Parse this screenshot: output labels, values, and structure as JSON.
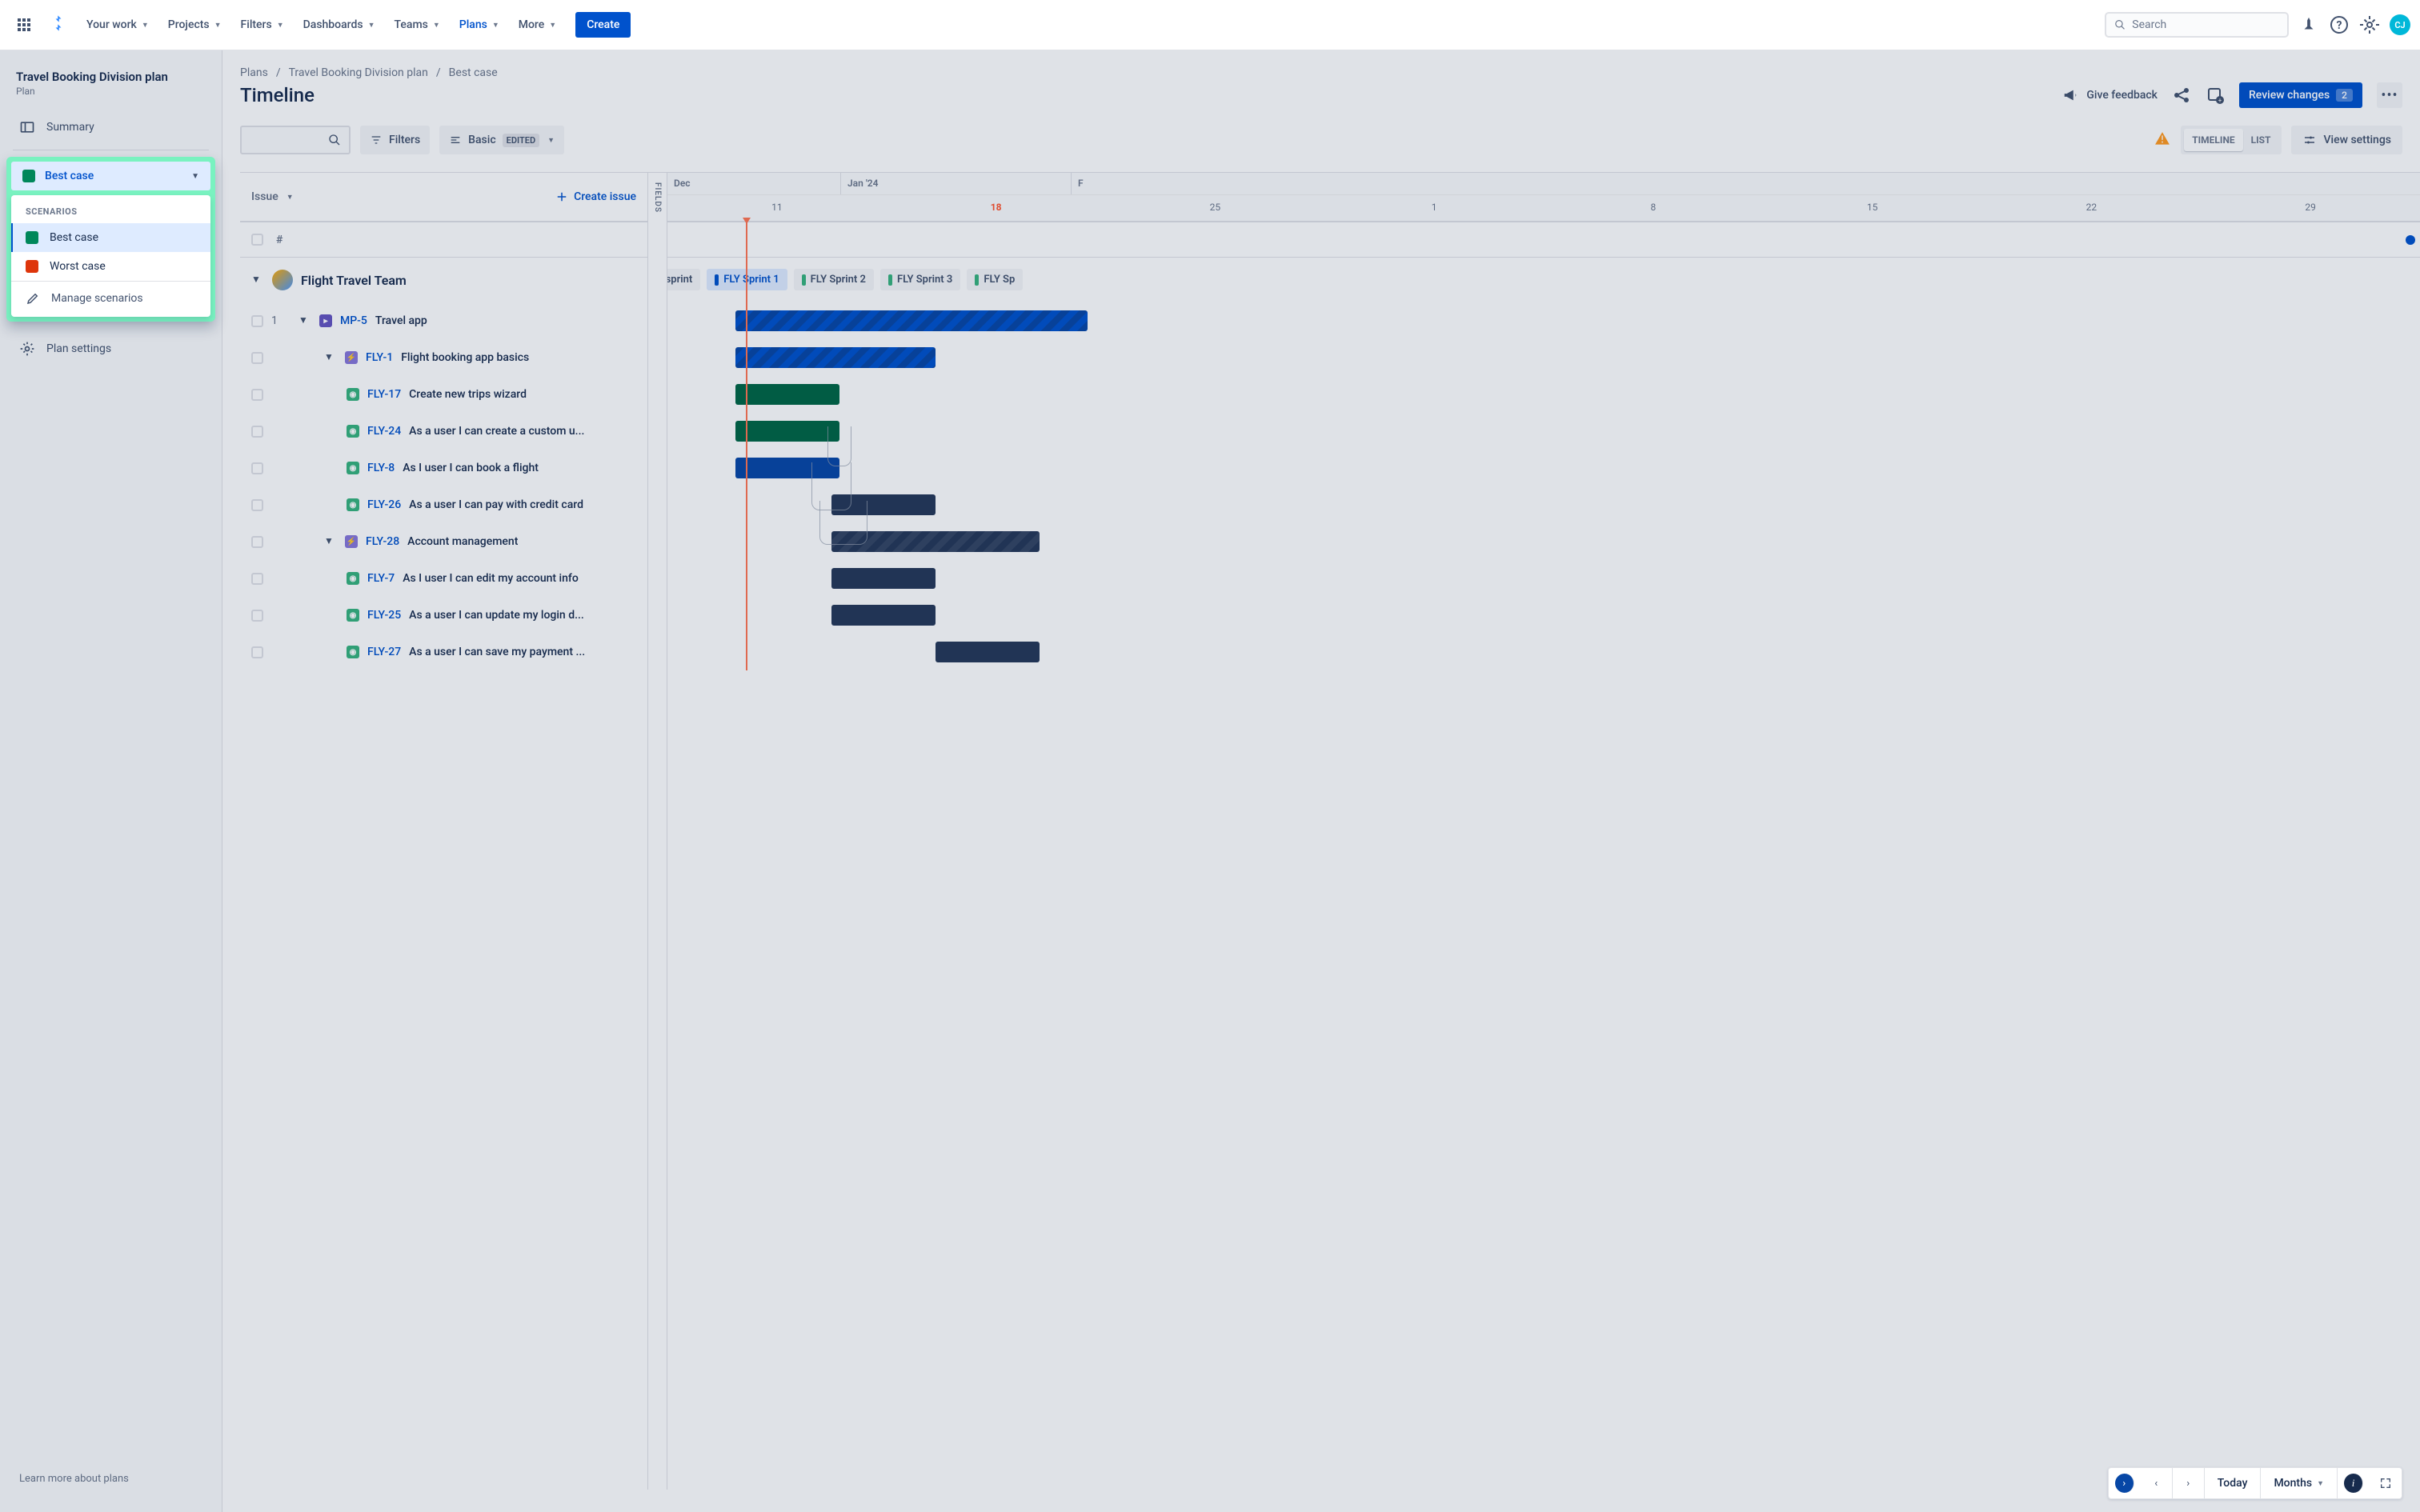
{
  "topnav": {
    "items": [
      "Your work",
      "Projects",
      "Filters",
      "Dashboards",
      "Teams",
      "Plans",
      "More"
    ],
    "active_index": 5,
    "create_label": "Create",
    "search_placeholder": "Search",
    "avatar_initials": "CJ"
  },
  "sidebar": {
    "plan_title": "Travel Booking Division plan",
    "plan_sub": "Plan",
    "summary_label": "Summary",
    "plan_settings_label": "Plan settings",
    "learn_link": "Learn more about plans"
  },
  "scenario": {
    "current": "Best case",
    "dropdown_header": "SCENARIOS",
    "items": [
      "Best case",
      "Worst case"
    ],
    "manage_label": "Manage scenarios"
  },
  "breadcrumb": [
    "Plans",
    "Travel Booking Division plan",
    "Best case"
  ],
  "page_title": "Timeline",
  "header_actions": {
    "feedback_label": "Give feedback",
    "review_label": "Review changes",
    "review_count": "2"
  },
  "filters": {
    "filters_label": "Filters",
    "basic_label": "Basic",
    "edited_tag": "EDITED",
    "view_tabs": [
      "TIMELINE",
      "LIST"
    ],
    "view_settings_label": "View settings"
  },
  "issues": {
    "header_label": "Issue",
    "create_label": "Create issue",
    "hash_label": "#",
    "fields_label": "FIELDS",
    "team_name": "Flight Travel Team",
    "rows": [
      {
        "num": "1",
        "key": "MP-5",
        "title": "Travel app",
        "type": "doc",
        "expandable": true,
        "indent": 1
      },
      {
        "key": "FLY-1",
        "title": "Flight booking app basics",
        "type": "epic",
        "expandable": true,
        "indent": 2
      },
      {
        "key": "FLY-17",
        "title": "Create new trips wizard",
        "type": "story",
        "indent": 3
      },
      {
        "key": "FLY-24",
        "title": "As a user I can create a custom u...",
        "type": "story",
        "indent": 3
      },
      {
        "key": "FLY-8",
        "title": "As I user I can book a flight",
        "type": "story",
        "indent": 3
      },
      {
        "key": "FLY-26",
        "title": "As a user I can pay with credit card",
        "type": "story",
        "indent": 3
      },
      {
        "key": "FLY-28",
        "title": "Account management",
        "type": "epic",
        "expandable": true,
        "indent": 2
      },
      {
        "key": "FLY-7",
        "title": "As I user I can edit my account info",
        "type": "story",
        "indent": 3
      },
      {
        "key": "FLY-25",
        "title": "As a user I can update my login d...",
        "type": "story",
        "indent": 3
      },
      {
        "key": "FLY-27",
        "title": "As a user I can save my payment ...",
        "type": "story",
        "indent": 3
      }
    ]
  },
  "gantt": {
    "months": [
      "Dec",
      "Jan '24",
      "F"
    ],
    "days": [
      "11",
      "18",
      "25",
      "1",
      "8",
      "15",
      "22",
      "29"
    ],
    "today_index": 1,
    "sprints": [
      "t sprint",
      "FLY Sprint 1",
      "FLY Sprint 2",
      "FLY Sprint 3",
      "FLY Sp"
    ]
  },
  "bottom_controls": {
    "today_label": "Today",
    "months_label": "Months"
  }
}
